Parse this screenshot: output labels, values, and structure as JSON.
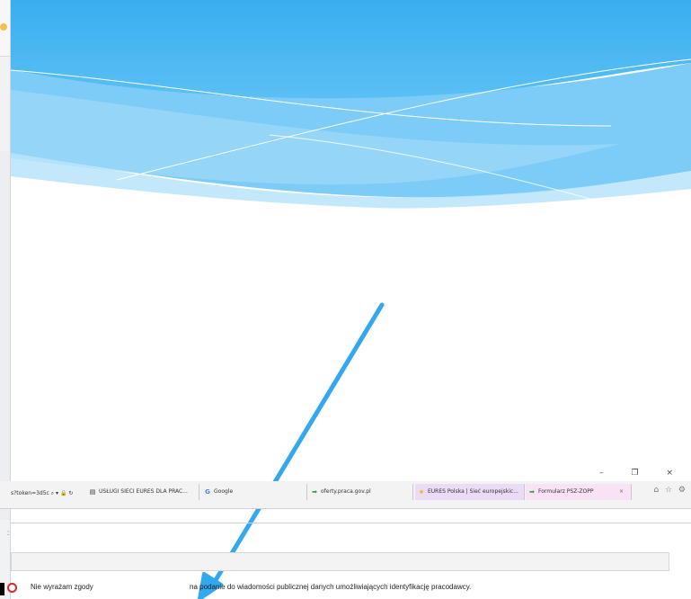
{
  "tabs": [
    {
      "label": "USŁUGI SIECI EURES DLA PRAC...",
      "icon": "news-icon"
    },
    {
      "label": "Google",
      "icon": "google-icon"
    },
    {
      "label": "oferty.praca.gov.pl",
      "icon": "arrow-green-icon"
    },
    {
      "label": "EURES Polska | Sieć europejskic...",
      "icon": "eures-icon"
    },
    {
      "label": "Formularz PSZ-ZOPP",
      "icon": "arrow-green-icon",
      "close": "×"
    }
  ],
  "address": {
    "fragment": "s?token=3d5c",
    "controls": "⌕ ▾ 🔒 ↻"
  },
  "window": {
    "controls": "– ❐ ×",
    "toolbar_icons": "⌂ ☆ ⚙"
  },
  "form": {
    "colon": ":",
    "option_label": "Nie wyrażam zgody",
    "sentence": "na podanie do wiadomości publicznej danych umożliwiających identyfikację pracodawcy."
  },
  "colors": {
    "sky": "#3db0ef",
    "wave": "#9fd8fa",
    "arrow": "#31a8f0",
    "radio": "#d42a2a"
  }
}
